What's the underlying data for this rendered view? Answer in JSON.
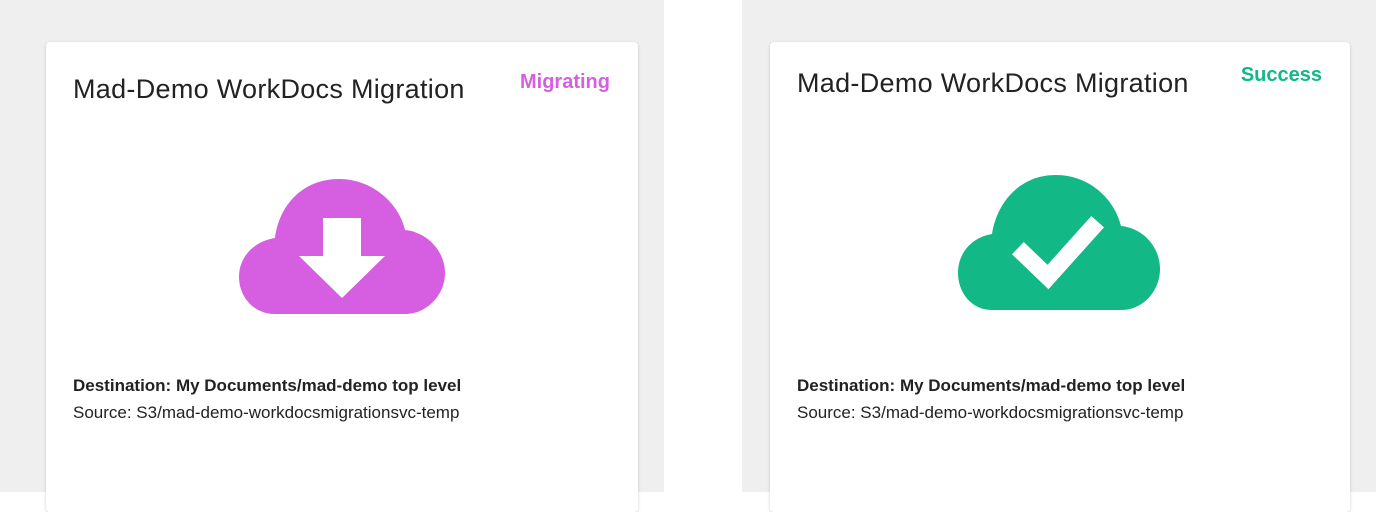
{
  "cards": [
    {
      "title": "Mad-Demo WorkDocs Migration",
      "status": "Migrating",
      "status_color": "#d65ee0",
      "icon": "cloud-download-icon",
      "destination": "Destination: My Documents/mad-demo top level",
      "source": "Source: S3/mad-demo-workdocsmigrationsvc-temp"
    },
    {
      "title": "Mad-Demo WorkDocs Migration",
      "status": "Success",
      "status_color": "#12b886",
      "icon": "cloud-check-icon",
      "destination": "Destination: My Documents/mad-demo top level",
      "source": "Source: S3/mad-demo-workdocsmigrationsvc-temp"
    }
  ]
}
